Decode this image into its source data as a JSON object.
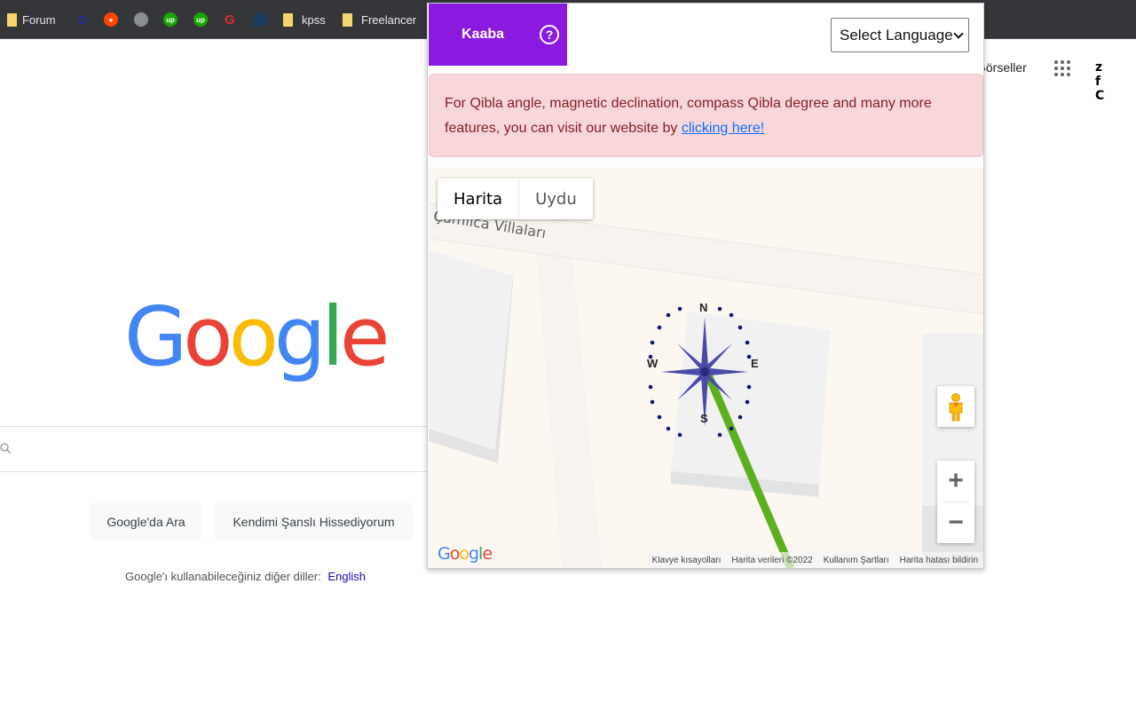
{
  "bookmarks": [
    {
      "type": "folder",
      "label": "Forum"
    },
    {
      "type": "favicon",
      "icon": "disney-icon",
      "color": "#1f2aa8"
    },
    {
      "type": "favicon",
      "icon": "reddit-icon",
      "color": "#ff4500"
    },
    {
      "type": "favicon",
      "icon": "globe-icon",
      "color": "#8a8d91"
    },
    {
      "type": "favicon",
      "icon": "upwork-icon",
      "color": "#14a800"
    },
    {
      "type": "favicon",
      "icon": "upwork-icon",
      "color": "#14a800"
    },
    {
      "type": "favicon",
      "icon": "g-red-icon",
      "color": "#d32f2f"
    },
    {
      "type": "favicon",
      "icon": "chat-bubble-icon",
      "color": "#1a3b5c"
    },
    {
      "type": "folder",
      "label": "kpss"
    },
    {
      "type": "folder",
      "label": "Freelancer"
    }
  ],
  "google": {
    "images_link": "Görseller",
    "account_logo": "z f C",
    "logo_letters": [
      {
        "ch": "G",
        "color": "#4285f4"
      },
      {
        "ch": "o",
        "color": "#ea4335"
      },
      {
        "ch": "o",
        "color": "#fbbc05"
      },
      {
        "ch": "g",
        "color": "#4285f4"
      },
      {
        "ch": "l",
        "color": "#34a853"
      },
      {
        "ch": "e",
        "color": "#ea4335"
      }
    ],
    "search_value": "",
    "search_button": "Google'da Ara",
    "lucky_button": "Kendimi Şanslı Hissediyorum",
    "language_prompt": "Google'ı kullanabileceğiniz diğer diller:",
    "language_link": "English"
  },
  "popup": {
    "title": "Kaaba",
    "help_icon": "?",
    "accent_color": "#8a1ae0",
    "language_select": {
      "selected": "Select Language"
    },
    "alert": {
      "text": "For Qibla angle, magnetic declination, compass Qibla degree and many more features, you can visit our website by",
      "link": "clicking here!"
    },
    "map": {
      "type_buttons": {
        "map": "Harita",
        "satellite": "Uydu"
      },
      "active_type": "Harita",
      "street_label": "g Çamlıca Villaları",
      "compass_labels": {
        "n": "N",
        "e": "E",
        "s": "S",
        "w": "W"
      },
      "qibla_line_color": "#5cb01e",
      "zoom_in": "+",
      "zoom_out": "−",
      "logo": "Google",
      "footer": [
        "Klavye kısayolları",
        "Harita verileri ©2022",
        "Kullanım Şartları",
        "Harita hatası bildirin"
      ]
    }
  }
}
